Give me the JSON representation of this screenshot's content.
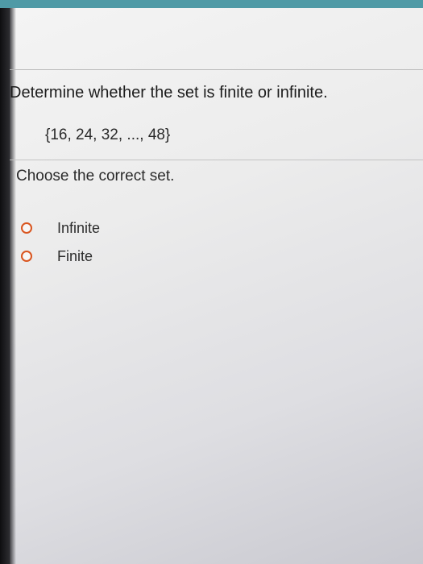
{
  "question": {
    "text": "Determine whether the set is finite or infinite.",
    "set": "{16, 24, 32, ..., 48}"
  },
  "prompt": "Choose the correct set.",
  "options": [
    {
      "label": "Infinite",
      "selected": false
    },
    {
      "label": "Finite",
      "selected": false
    }
  ],
  "colors": {
    "radio_border": "#d9551f",
    "top_strip": "#4f9aa6"
  }
}
